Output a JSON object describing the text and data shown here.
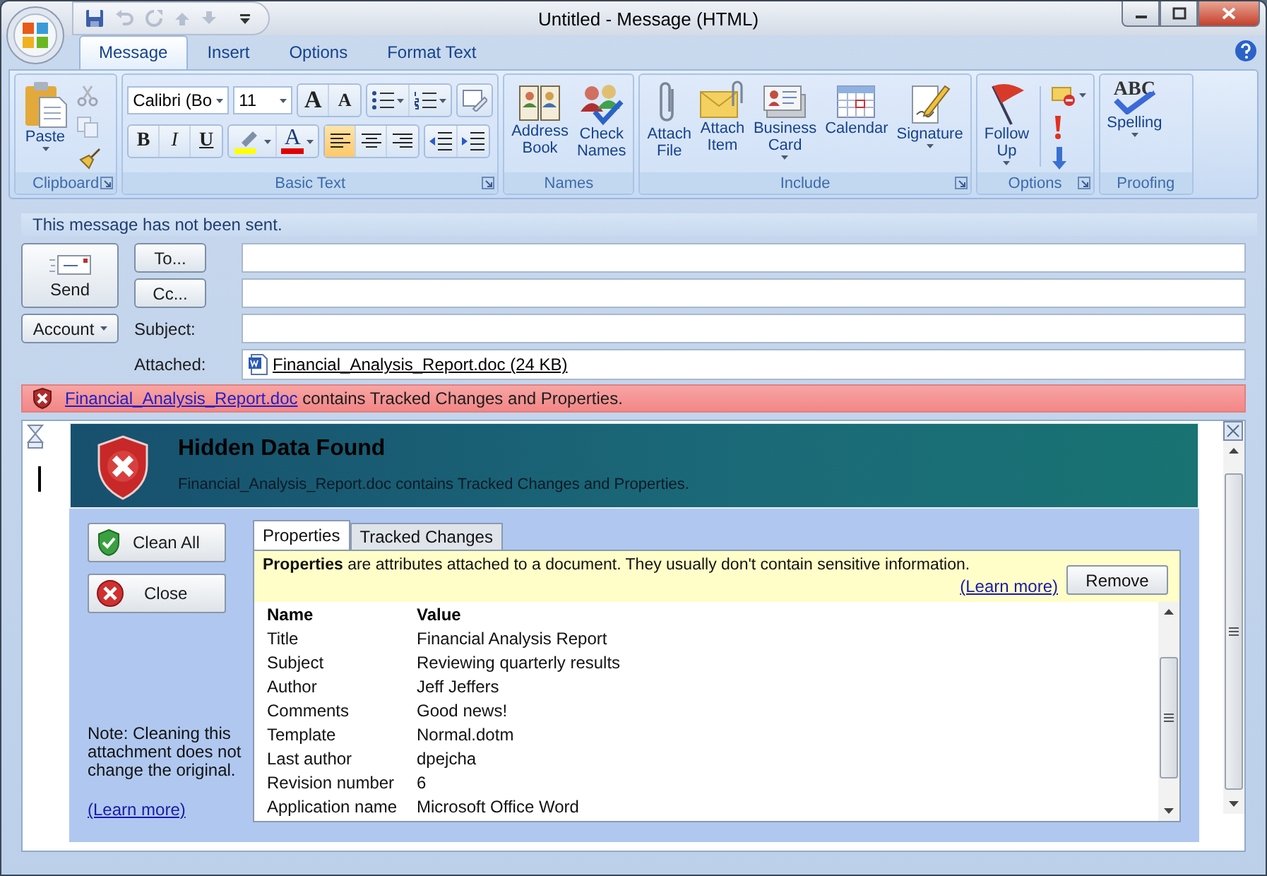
{
  "window": {
    "title": "Untitled - Message (HTML)"
  },
  "quick_access": [
    {
      "kind": "save",
      "disabled": false
    },
    {
      "kind": "undo",
      "disabled": true
    },
    {
      "kind": "redo",
      "disabled": true
    },
    {
      "kind": "previous",
      "disabled": true
    },
    {
      "kind": "next",
      "disabled": true
    },
    {
      "kind": "customize",
      "disabled": false
    }
  ],
  "ribbon_tabs": [
    {
      "label": "Message",
      "selected": true
    },
    {
      "label": "Insert",
      "selected": false
    },
    {
      "label": "Options",
      "selected": false
    },
    {
      "label": "Format Text",
      "selected": false
    }
  ],
  "ribbon_groups": [
    {
      "kind": "standard",
      "label": "Clipboard",
      "launcher": true,
      "buttons": [
        {
          "kind": "paste",
          "label": "Paste",
          "dropdown": true
        }
      ],
      "stack": [
        {
          "kind": "cut",
          "disabled": true,
          "dropdown": false
        },
        {
          "kind": "copy",
          "disabled": true,
          "dropdown": false
        },
        {
          "kind": "format-painter",
          "disabled": false,
          "dropdown": false
        }
      ]
    },
    {
      "kind": "basic-text",
      "label": "Basic Text",
      "launcher": true,
      "font": "Calibri (Bo",
      "size": "11",
      "rows": [
        [
          [
            {
              "kind": "grow-font",
              "text": "A"
            },
            {
              "kind": "shrink-font",
              "text": "A"
            }
          ],
          [
            {
              "kind": "bullets",
              "dropdown": true
            },
            {
              "kind": "numbering",
              "dropdown": true
            }
          ],
          [
            {
              "kind": "styles"
            }
          ]
        ],
        [
          [
            {
              "kind": "bold",
              "text": "B"
            },
            {
              "kind": "italic",
              "text": "I"
            },
            {
              "kind": "underline",
              "text": "U"
            }
          ],
          [
            {
              "kind": "highlight",
              "dropdown": true
            },
            {
              "kind": "font-color",
              "text": "A",
              "dropdown": true
            }
          ],
          [
            {
              "kind": "align-left",
              "selected": true
            },
            {
              "kind": "align-center",
              "selected": false
            },
            {
              "kind": "align-right",
              "selected": false
            }
          ],
          [
            {
              "kind": "outdent"
            },
            {
              "kind": "indent"
            }
          ]
        ]
      ]
    },
    {
      "kind": "standard",
      "label": "Names",
      "launcher": false,
      "buttons": [
        {
          "kind": "address-book",
          "label": "Address Book",
          "dropdown": false
        },
        {
          "kind": "check-names",
          "label": "Check Names",
          "dropdown": false
        }
      ]
    },
    {
      "kind": "standard",
      "label": "Include",
      "launcher": true,
      "buttons": [
        {
          "kind": "attach-file",
          "label": "Attach File",
          "dropdown": false
        },
        {
          "kind": "attach-item",
          "label": "Attach Item",
          "dropdown": false
        },
        {
          "kind": "business-card",
          "label": "Business Card",
          "dropdown": true
        },
        {
          "kind": "calendar",
          "label": "Calendar",
          "dropdown": false
        },
        {
          "kind": "signature",
          "label": "Signature",
          "dropdown": true
        }
      ]
    },
    {
      "kind": "standard",
      "label": "Options",
      "launcher": true,
      "buttons": [
        {
          "kind": "follow-up",
          "label": "Follow Up",
          "dropdown": true
        }
      ],
      "stack": [
        {
          "kind": "permission",
          "disabled": false,
          "dropdown": true
        },
        {
          "kind": "high-importance",
          "disabled": false,
          "dropdown": false
        },
        {
          "kind": "low-importance",
          "disabled": false,
          "dropdown": false
        }
      ]
    },
    {
      "kind": "standard",
      "label": "Proofing",
      "launcher": false,
      "buttons": [
        {
          "kind": "spelling",
          "label": "Spelling",
          "icon_text": "ABC",
          "dropdown": true
        }
      ]
    }
  ],
  "info_bar": "This message has not been sent.",
  "send": {
    "label": "Send"
  },
  "address_fields": [
    {
      "label": "To..."
    },
    {
      "label": "Cc..."
    }
  ],
  "account": {
    "label": "Account"
  },
  "subject": {
    "label": "Subject:"
  },
  "attached": {
    "label": "Attached:",
    "file": "Financial_Analysis_Report.doc (24 KB)"
  },
  "alert_bar": {
    "link": "Financial_Analysis_Report.doc",
    "text": " contains Tracked Changes and Properties."
  },
  "dialog": {
    "title": "Hidden Data Found",
    "subtitle": "Financial_Analysis_Report.doc contains Tracked Changes and Properties.",
    "actions": [
      {
        "kind": "clean",
        "label": "Clean All"
      },
      {
        "kind": "close",
        "label": "Close"
      }
    ],
    "note": "Note: Cleaning this attachment does not change the original.",
    "note_link": "(Learn more)",
    "tabs": [
      {
        "label": "Properties",
        "selected": true
      },
      {
        "label": "Tracked Changes",
        "selected": false
      }
    ],
    "description": "**Properties** are attributes attached to a document.  They usually don't contain sensitive information.",
    "description_link": "(Learn more)",
    "remove_button": "Remove",
    "table": {
      "columns": [
        "Name",
        "Value"
      ],
      "rows": [
        [
          "Title",
          "Financial Analysis Report"
        ],
        [
          "Subject",
          "Reviewing quarterly results"
        ],
        [
          "Author",
          "Jeff Jeffers"
        ],
        [
          "Comments",
          "Good news!"
        ],
        [
          "Template",
          "Normal.dotm"
        ],
        [
          "Last author",
          "dpejcha"
        ],
        [
          "Revision number",
          "6"
        ],
        [
          "Application name",
          "Microsoft Office Word"
        ]
      ]
    }
  }
}
